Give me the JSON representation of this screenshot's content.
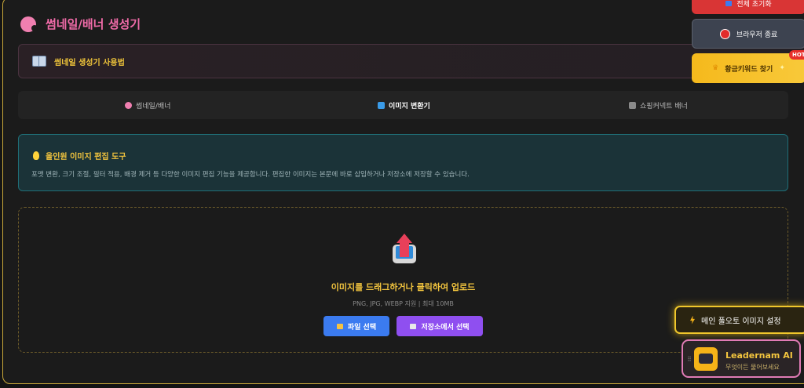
{
  "header": {
    "title": "썸네일/배너 생성기",
    "icon": "palette-icon"
  },
  "guide": {
    "label": "썸네일 생성기 사용법",
    "icon": "book-icon"
  },
  "tabs": [
    {
      "label": "썸네일/배너",
      "icon": "palette-icon",
      "active": false
    },
    {
      "label": "이미지 변환기",
      "icon": "image-icon",
      "active": true
    },
    {
      "label": "쇼핑커넥트 배너",
      "icon": "shop-icon",
      "active": false
    }
  ],
  "info": {
    "title": "올인원 이미지 편집 도구",
    "description": "포맷 변환, 크기 조절, 필터 적용, 배경 제거 등 다양한 이미지 편집 기능을 제공합니다. 편집한 이미지는 본문에 바로 삽입하거나 저장소에 저장할 수 있습니다."
  },
  "upload": {
    "title": "이미지를 드래그하거나 클릭하여 업로드",
    "subtitle": "PNG, JPG, WEBP 지원 | 최대 10MB",
    "file_button": "파일 선택",
    "storage_button": "저장소에서 선택"
  },
  "floating": {
    "top_label": "전체 초기화",
    "browser_close": "브라우저 종료",
    "gold_keyword": "황금키워드 찾기",
    "hot_badge": "HOT",
    "auto_image": "메인 풀오토 이미지 설정"
  },
  "assistant": {
    "name": "Leadernam AI",
    "subtitle": "무엇이든 물어보세요"
  },
  "colors": {
    "accent_yellow": "#f3c53e",
    "accent_pink": "#f06ba8",
    "file_blue": "#3b7bf0",
    "storage_purple": "#8f4ff0"
  }
}
